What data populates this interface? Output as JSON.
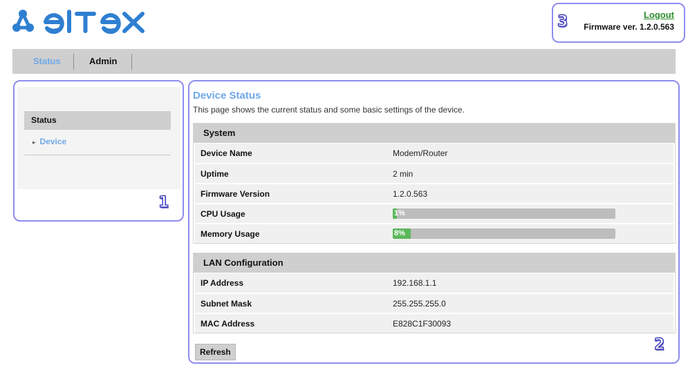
{
  "header": {
    "logo_text": "ELTEX",
    "logout_label": "Logout",
    "firmware_label": "Firmware ver. 1.2.0.563"
  },
  "nav": {
    "tabs": [
      {
        "label": "Status",
        "active": true
      },
      {
        "label": "Admin",
        "active": false
      }
    ]
  },
  "sidebar": {
    "section_label": "Status",
    "items": [
      {
        "label": "Device",
        "icon": "chevron-right-icon"
      }
    ]
  },
  "main": {
    "title": "Device Status",
    "description": "This page shows the current status and some basic settings of the device.",
    "system": {
      "heading": "System",
      "rows": [
        {
          "label": "Device Name",
          "value": "Modem/Router"
        },
        {
          "label": "Uptime",
          "value": "2 min"
        },
        {
          "label": "Firmware Version",
          "value": "1.2.0.563"
        }
      ],
      "cpu": {
        "label": "CPU Usage",
        "percent_text": "1%",
        "percent": 1
      },
      "memory": {
        "label": "Memory Usage",
        "percent_text": "8%",
        "percent": 8
      }
    },
    "lan": {
      "heading": "LAN Configuration",
      "rows": [
        {
          "label": "IP Address",
          "value": "192.168.1.1"
        },
        {
          "label": "Subnet Mask",
          "value": "255.255.255.0"
        },
        {
          "label": "MAC Address",
          "value": "E828C1F30093"
        }
      ]
    },
    "refresh_label": "Refresh"
  },
  "annotations": {
    "badge_1": "1",
    "badge_2": "2",
    "badge_3": "3"
  },
  "colors": {
    "brand_blue": "#2f7fd1",
    "link_blue": "#6fa8e8",
    "logout_green": "#2c8c2c",
    "progress_green": "#5cb85c",
    "annotation_outline": "#8f8cf0"
  }
}
